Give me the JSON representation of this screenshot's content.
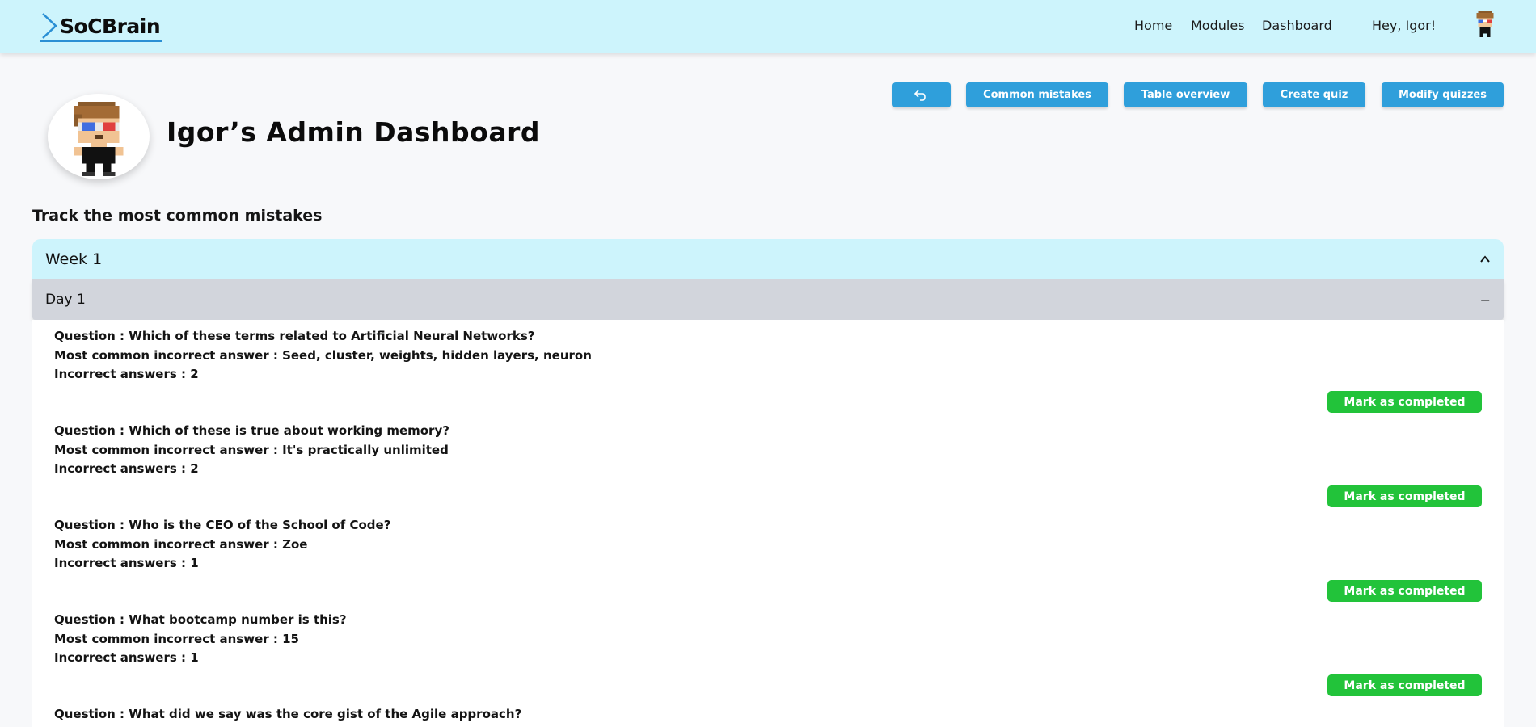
{
  "header": {
    "logo": "SoCBrain",
    "nav": {
      "home": "Home",
      "modules": "Modules",
      "dashboard": "Dashboard"
    },
    "greeting": "Hey, Igor!"
  },
  "page": {
    "title": "Igor’s Admin Dashboard",
    "section_heading": "Track the most common mistakes"
  },
  "actions": {
    "back_icon": "undo-arrow-icon",
    "common_mistakes": "Common mistakes",
    "table_overview": "Table overview",
    "create_quiz": "Create quiz",
    "modify_quizzes": "Modify quizzes"
  },
  "accordion": {
    "week_label": "Week 1",
    "week_icon": "chevron-up-icon",
    "day_label": "Day 1",
    "day_icon": "−"
  },
  "mistakes": [
    {
      "question": "Question : Which of these terms related to Artificial Neural Networks?",
      "answer": "Most common incorrect answer : Seed, cluster, weights, hidden layers, neuron",
      "count": "Incorrect answers : 2",
      "button": "Mark as completed"
    },
    {
      "question": "Question : Which of these is true about working memory?",
      "answer": "Most common incorrect answer : It's practically unlimited",
      "count": "Incorrect answers : 2",
      "button": "Mark as completed"
    },
    {
      "question": "Question : Who is the CEO of the School of Code?",
      "answer": "Most common incorrect answer : Zoe",
      "count": "Incorrect answers : 1",
      "button": "Mark as completed"
    },
    {
      "question": "Question : What bootcamp number is this?",
      "answer": "Most common incorrect answer : 15",
      "count": "Incorrect answers : 1",
      "button": "Mark as completed"
    },
    {
      "question": "Question : What did we say was the core gist of the Agile approach?",
      "answer": "",
      "count": "",
      "button": ""
    }
  ],
  "colors": {
    "header_bg": "#cdf4fc",
    "action_button": "#2f9fdb",
    "complete_button": "#22c33a",
    "day_row_bg": "#d2d5dc"
  }
}
